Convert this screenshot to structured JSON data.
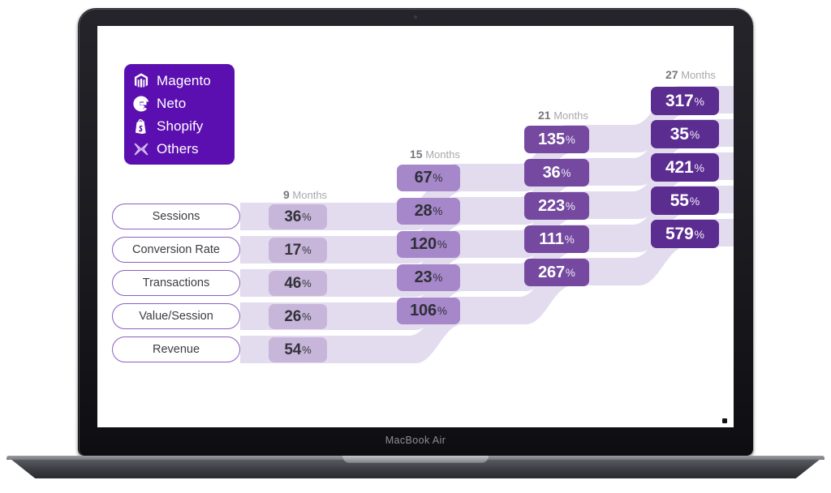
{
  "device": {
    "bezel_label": "MacBook Air"
  },
  "brand_box": {
    "accent": "#5c0fb0",
    "items": [
      {
        "icon": "magento-icon",
        "label": "Magento"
      },
      {
        "icon": "neto-icon",
        "label": "Neto"
      },
      {
        "icon": "shopify-icon",
        "label": "Shopify"
      },
      {
        "icon": "others-x-icon",
        "label": "Others"
      }
    ]
  },
  "chart_data": {
    "type": "table",
    "title": "",
    "xlabel": "",
    "ylabel": "",
    "grid": false,
    "legend": "none",
    "categories": [
      "Sessions",
      "Conversion Rate",
      "Transactions",
      "Value/Session",
      "Revenue"
    ],
    "columns": [
      {
        "number": "9",
        "unit": "Months",
        "color": "#c7b6da"
      },
      {
        "number": "15",
        "unit": "Months",
        "color": "#a688ca"
      },
      {
        "number": "21",
        "unit": "Months",
        "color": "#74499f"
      },
      {
        "number": "27",
        "unit": "Months",
        "color": "#5c2d91"
      }
    ],
    "unit_suffix": "%",
    "series": [
      {
        "name": "9 Months",
        "values": [
          36,
          17,
          46,
          26,
          54
        ]
      },
      {
        "name": "15 Months",
        "values": [
          67,
          28,
          120,
          23,
          106
        ]
      },
      {
        "name": "21 Months",
        "values": [
          135,
          36,
          223,
          111,
          267
        ]
      },
      {
        "name": "27 Months",
        "values": [
          317,
          35,
          421,
          55,
          579
        ]
      }
    ],
    "cells": {
      "m9": [
        "36",
        "17",
        "46",
        "26",
        "54"
      ],
      "m15": [
        "67",
        "28",
        "120",
        "23",
        "106"
      ],
      "m21": [
        "135",
        "36",
        "223",
        "111",
        "267"
      ],
      "m27": [
        "317",
        "35",
        "421",
        "55",
        "579"
      ]
    },
    "headers": {
      "h9_num": "9",
      "h9_unit": "Months",
      "h15_num": "15",
      "h15_unit": "Months",
      "h21_num": "21",
      "h21_unit": "Months",
      "h27_num": "27",
      "h27_unit": "Months"
    },
    "pct": "%"
  }
}
